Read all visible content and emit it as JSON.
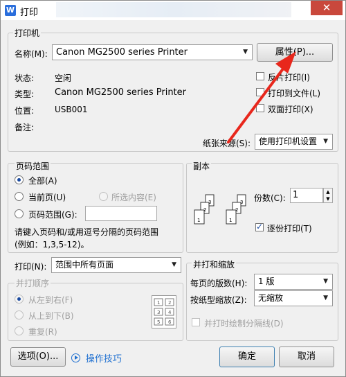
{
  "window": {
    "title": "打印",
    "app_icon": "W",
    "close": "✕"
  },
  "printer": {
    "group": "打印机",
    "name_label": "名称(M):",
    "name_value": "Canon MG2500 series Printer",
    "properties": "属性(P)...",
    "status_label": "状态:",
    "status_value": "空闲",
    "type_label": "类型:",
    "type_value": "Canon MG2500 series Printer",
    "where_label": "位置:",
    "where_value": "USB001",
    "comment_label": "备注:",
    "reverse_print": "反片打印(I)",
    "print_to_file": "打印到文件(L)",
    "duplex": "双面打印(X)",
    "paper_source_label": "纸张来源(S):",
    "paper_source_value": "使用打印机设置"
  },
  "page_range": {
    "group": "页码范围",
    "all": "全部(A)",
    "current": "当前页(U)",
    "selection": "所选内容(E)",
    "pages": "页码范围(G):",
    "hint1": "请键入页码和/或用逗号分隔的页码范围",
    "hint2": "(例如：1,3,5-12)。"
  },
  "copies": {
    "group": "副本",
    "count_label": "份数(C):",
    "count_value": "1",
    "collate": "逐份打印(T)",
    "page_nums": [
      "3",
      "2",
      "1",
      "3",
      "2",
      "1"
    ]
  },
  "print_what": {
    "label": "打印(N):",
    "value": "范围中所有页面"
  },
  "order": {
    "group": "并打顺序",
    "ltr": "从左到右(F)",
    "ttb": "从上到下(B)",
    "repeat": "重复(R)",
    "grid": [
      "1",
      "2",
      "3",
      "4",
      "5",
      "6"
    ]
  },
  "zoom": {
    "group": "并打和缩放",
    "per_sheet_label": "每页的版数(H):",
    "per_sheet_value": "1 版",
    "scale_label": "按纸型缩放(Z):",
    "scale_value": "无缩放",
    "separator": "并打时绘制分隔线(D)"
  },
  "footer": {
    "options": "选项(O)...",
    "tips": "操作技巧",
    "ok": "确定",
    "cancel": "取消"
  },
  "colors": {
    "annotation_arrow": "#e8271c",
    "link": "#1e6fd0",
    "titlebar_close": "#c9483c"
  }
}
